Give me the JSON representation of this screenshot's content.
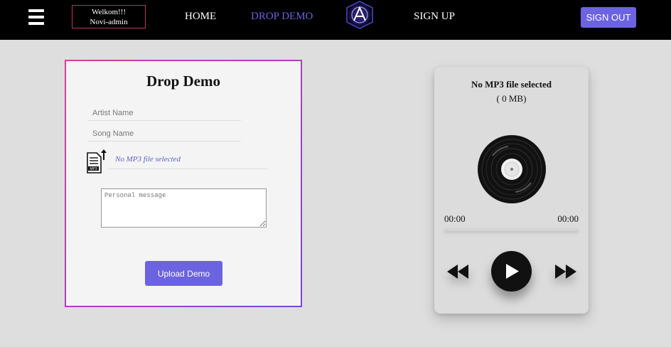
{
  "header": {
    "welcome_line1": "Welkom!!!",
    "welcome_line2": "Novi-admin",
    "nav": {
      "home": "HOME",
      "drop_demo": "DROP DEMO",
      "sign_up": "SIGN UP"
    },
    "sign_out_label": "SIGN OUT"
  },
  "form": {
    "title": "Drop Demo",
    "artist_placeholder": "Artist Name",
    "artist_value": "",
    "song_placeholder": "Song Name",
    "song_value": "",
    "file_icon_text": "MP3",
    "file_status": "No MP3 file selected",
    "message_placeholder": "Personal message",
    "message_value": "",
    "upload_label": "Upload Demo"
  },
  "player": {
    "title": "No MP3 file selected",
    "size": "( 0 MB)",
    "current_time": "00:00",
    "duration": "00:00",
    "progress": 0
  },
  "colors": {
    "accent": "#6c63e0",
    "topbar": "#000000",
    "background": "#dedede",
    "card_border_start": "#d6409a",
    "card_border_end": "#7b45d8"
  },
  "icons": {
    "menu": "hamburger-icon",
    "logo": "brand-logo",
    "file": "mp3-file-upload-icon",
    "disc": "vinyl-record-icon",
    "rewind": "rewind-icon",
    "play": "play-icon",
    "forward": "fast-forward-icon"
  }
}
